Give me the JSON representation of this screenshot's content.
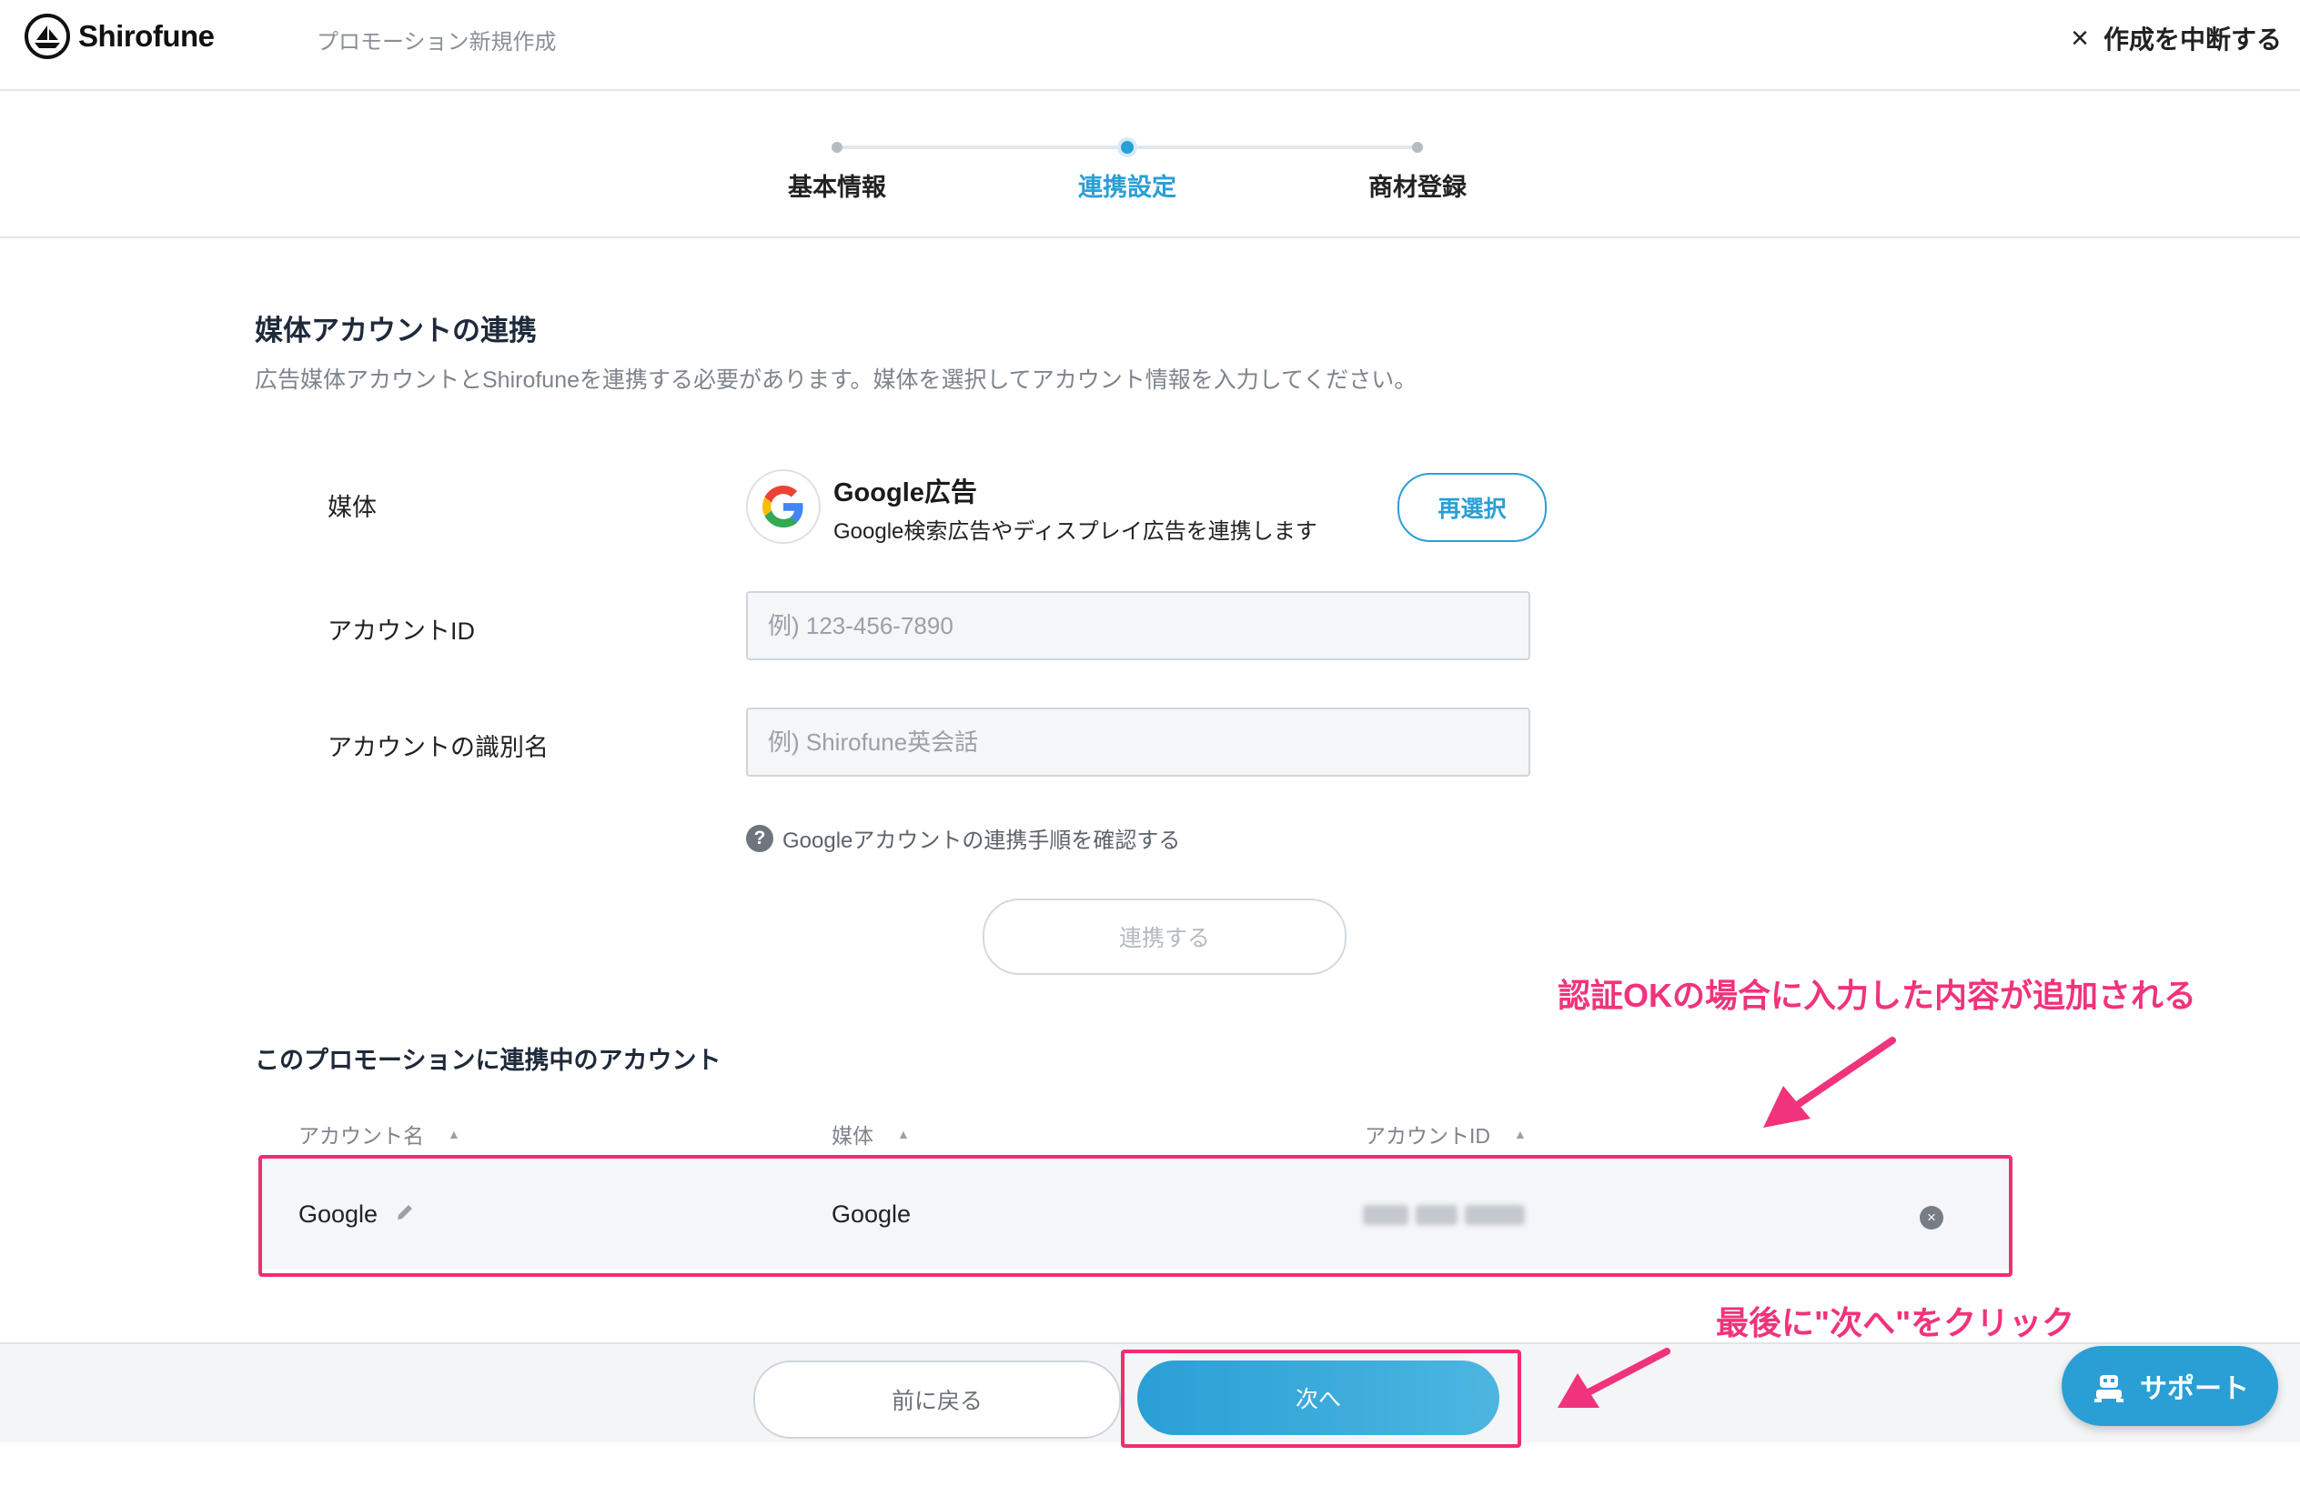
{
  "header": {
    "brand": "Shirofune",
    "page_title": "プロモーション新規作成",
    "abort_label": "作成を中断する"
  },
  "stepper": {
    "steps": [
      {
        "label": "基本情報",
        "state": "done"
      },
      {
        "label": "連携設定",
        "state": "active"
      },
      {
        "label": "商材登録",
        "state": "pending"
      }
    ]
  },
  "section": {
    "title": "媒体アカウントの連携",
    "description": "広告媒体アカウントとShirofuneを連携する必要があります。媒体を選択してアカウント情報を入力してください。"
  },
  "form": {
    "media_label": "媒体",
    "media_name": "Google広告",
    "media_description": "Google検索広告やディスプレイ広告を連携します",
    "reselect_label": "再選択",
    "account_id_label": "アカウントID",
    "account_id_placeholder": "例) 123-456-7890",
    "account_name_label": "アカウントの識別名",
    "account_name_placeholder": "例) Shirofune英会話",
    "help_text": "Googleアカウントの連携手順を確認する",
    "link_button": "連携する"
  },
  "annotations": {
    "added_note": "認証OKの場合に入力した内容が追加される",
    "next_note": "最後に\"次へ\"をクリック"
  },
  "linked_accounts": {
    "title": "このプロモーションに連携中のアカウント",
    "columns": [
      "アカウント名",
      "媒体",
      "アカウントID"
    ],
    "rows": [
      {
        "name": "Google",
        "media": "Google"
      }
    ]
  },
  "footer": {
    "back_label": "前に戻る",
    "next_label": "次へ",
    "support_label": "サポート"
  },
  "colors": {
    "accent": "#2a9fd6",
    "annotation": "#f0337c"
  }
}
